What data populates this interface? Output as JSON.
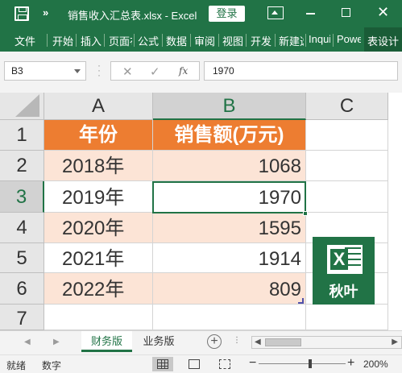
{
  "titlebar": {
    "more": "»",
    "title": "销售收入汇总表.xlsx  -  Excel",
    "login": "登录"
  },
  "ribbon": {
    "tabs": [
      "文件",
      "开始",
      "插入",
      "页面布局",
      "公式",
      "数据",
      "审阅",
      "视图",
      "开发工具",
      "新建选项卡",
      "Inquire",
      "Power Pivot",
      "表设计"
    ]
  },
  "formula_bar": {
    "name_box": "B3",
    "fx": "fx",
    "value": "1970"
  },
  "grid": {
    "columns": [
      "A",
      "B",
      "C"
    ],
    "rows": [
      "1",
      "2",
      "3",
      "4",
      "5",
      "6",
      "7"
    ],
    "header": [
      "年份",
      "销售额(万元)"
    ],
    "data": [
      [
        "2018年",
        "1068"
      ],
      [
        "2019年",
        "1970"
      ],
      [
        "2020年",
        "1595"
      ],
      [
        "2021年",
        "1914"
      ],
      [
        "2022年",
        "809"
      ]
    ],
    "selected_cell": "B3"
  },
  "logo": {
    "text": "秋叶",
    "mark": "X"
  },
  "sheets": {
    "tabs": [
      "财务版",
      "业务版"
    ],
    "active": "财务版",
    "add": "+"
  },
  "statusbar": {
    "ready": "就绪",
    "num": "数字",
    "zoom": "200%",
    "zoom_level": 0.57
  },
  "colors": {
    "accent": "#217346",
    "header_fill": "#ed7d31",
    "band_fill": "#fce4d6"
  },
  "icons": [
    "save-icon",
    "customize-qat-icon",
    "ribbon-display-icon",
    "minimize-icon",
    "maximize-icon",
    "close-icon",
    "cancel-icon",
    "enter-icon",
    "insert-function-icon"
  ]
}
